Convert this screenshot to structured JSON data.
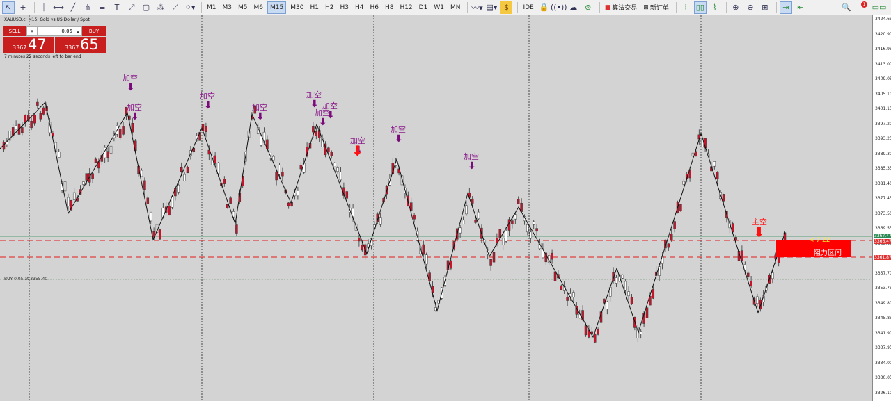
{
  "toolbar": {
    "tools": [
      "cursor-icon",
      "crosshair-icon",
      "vline-icon",
      "hline-icon",
      "trendline-icon",
      "pitchfork-icon",
      "channel-icon",
      "text-tool-icon",
      "fib-icon",
      "rectangle-icon",
      "arrows-icon",
      "shapes-icon",
      "more-tools-icon"
    ],
    "timeframes": [
      "M1",
      "M3",
      "M5",
      "M6",
      "M15",
      "M30",
      "H1",
      "H2",
      "H3",
      "H4",
      "H6",
      "H8",
      "H12",
      "D1",
      "W1",
      "MN"
    ],
    "selected_timeframe": "M15",
    "ide": "IDE",
    "algo_trading": "算法交易",
    "new_order": "新订单",
    "notifications_count": "1"
  },
  "symbol": {
    "title": "XAUUSD.c, M15:  Gold vs US Dollar / Spot"
  },
  "trade_panel": {
    "sell": "SELL",
    "buy": "BUY",
    "lot": "0.05",
    "sell_small": "3367",
    "sell_big": "47",
    "buy_small": "3367",
    "buy_big": "65"
  },
  "countdown": "7 minutes 22 seconds left to bar end",
  "buy_line_label": "BUY 0.05 at 3355.40",
  "resistance": {
    "label": "阻力区间",
    "tag": "< 7.22"
  },
  "price_axis": {
    "labels": [
      "3424.65",
      "3420.90",
      "3416.95",
      "3413.00",
      "3409.05",
      "3405.10",
      "3401.15",
      "3397.20",
      "3393.25",
      "3389.30",
      "3385.35",
      "3381.40",
      "3377.45",
      "3373.50",
      "3369.55",
      "3365.60",
      "3361.87",
      "3357.70",
      "3353.75",
      "3349.80",
      "3345.85",
      "3341.90",
      "3337.95",
      "3334.00",
      "3330.05",
      "3326.10"
    ],
    "tag_current": "3367.47",
    "tag_resist_top": "3366.47",
    "tag_resist_bottom": "3361.87"
  },
  "signals": [
    {
      "text": "加空"
    },
    {
      "text": "加空"
    },
    {
      "text": "加空"
    },
    {
      "text": "加空"
    },
    {
      "text": "加空"
    },
    {
      "text": "加空"
    },
    {
      "text": "加空"
    },
    {
      "text": "加空"
    },
    {
      "text": "加空"
    },
    {
      "text": "加空"
    },
    {
      "text": "主空"
    }
  ],
  "colors": {
    "chart_bg": "#d3d3d3",
    "candle_up": "#ffffff",
    "candle_down": "#c8142b",
    "signal": "#8a1b8a",
    "main_signal": "#ff0000",
    "resistance": "#ff0000"
  }
}
